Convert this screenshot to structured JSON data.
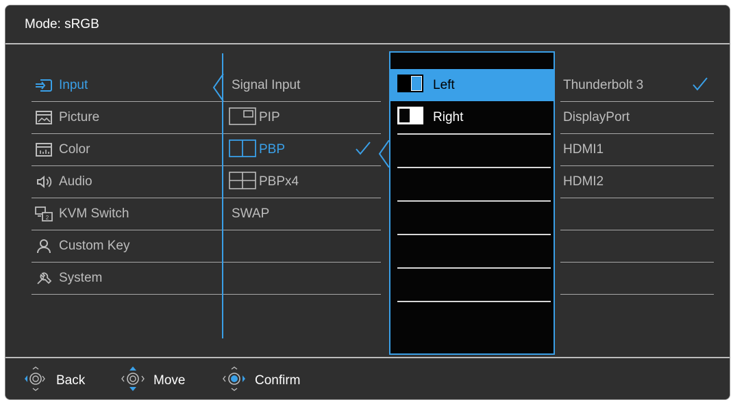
{
  "header": {
    "mode_text": "Mode: sRGB"
  },
  "main_menu": [
    {
      "label": "Input",
      "icon": "input-icon",
      "active": true
    },
    {
      "label": "Picture",
      "icon": "picture-icon"
    },
    {
      "label": "Color",
      "icon": "color-icon"
    },
    {
      "label": "Audio",
      "icon": "audio-icon"
    },
    {
      "label": "KVM Switch",
      "icon": "kvm-switch-icon"
    },
    {
      "label": "Custom Key",
      "icon": "custom-key-icon"
    },
    {
      "label": "System",
      "icon": "system-icon"
    }
  ],
  "sub_menu": [
    {
      "label": "Signal Input"
    },
    {
      "label": "PIP",
      "icon": "pip-icon"
    },
    {
      "label": "PBP",
      "icon": "pbp-icon",
      "active": true,
      "checked": true
    },
    {
      "label": "PBPx4",
      "icon": "pbpx4-icon"
    },
    {
      "label": "SWAP"
    }
  ],
  "position_menu": [
    {
      "label": "Left",
      "icon": "left-window-icon",
      "selected": true
    },
    {
      "label": "Right",
      "icon": "right-window-icon"
    }
  ],
  "source_menu": [
    {
      "label": "Thunderbolt 3",
      "checked": true
    },
    {
      "label": "DisplayPort"
    },
    {
      "label": "HDMI1"
    },
    {
      "label": "HDMI2"
    }
  ],
  "footer": {
    "back_label": "Back",
    "move_label": "Move",
    "confirm_label": "Confirm"
  },
  "colors": {
    "accent": "#3aa0e8",
    "background": "#2f2f2f",
    "text": "#bdbdbd"
  }
}
